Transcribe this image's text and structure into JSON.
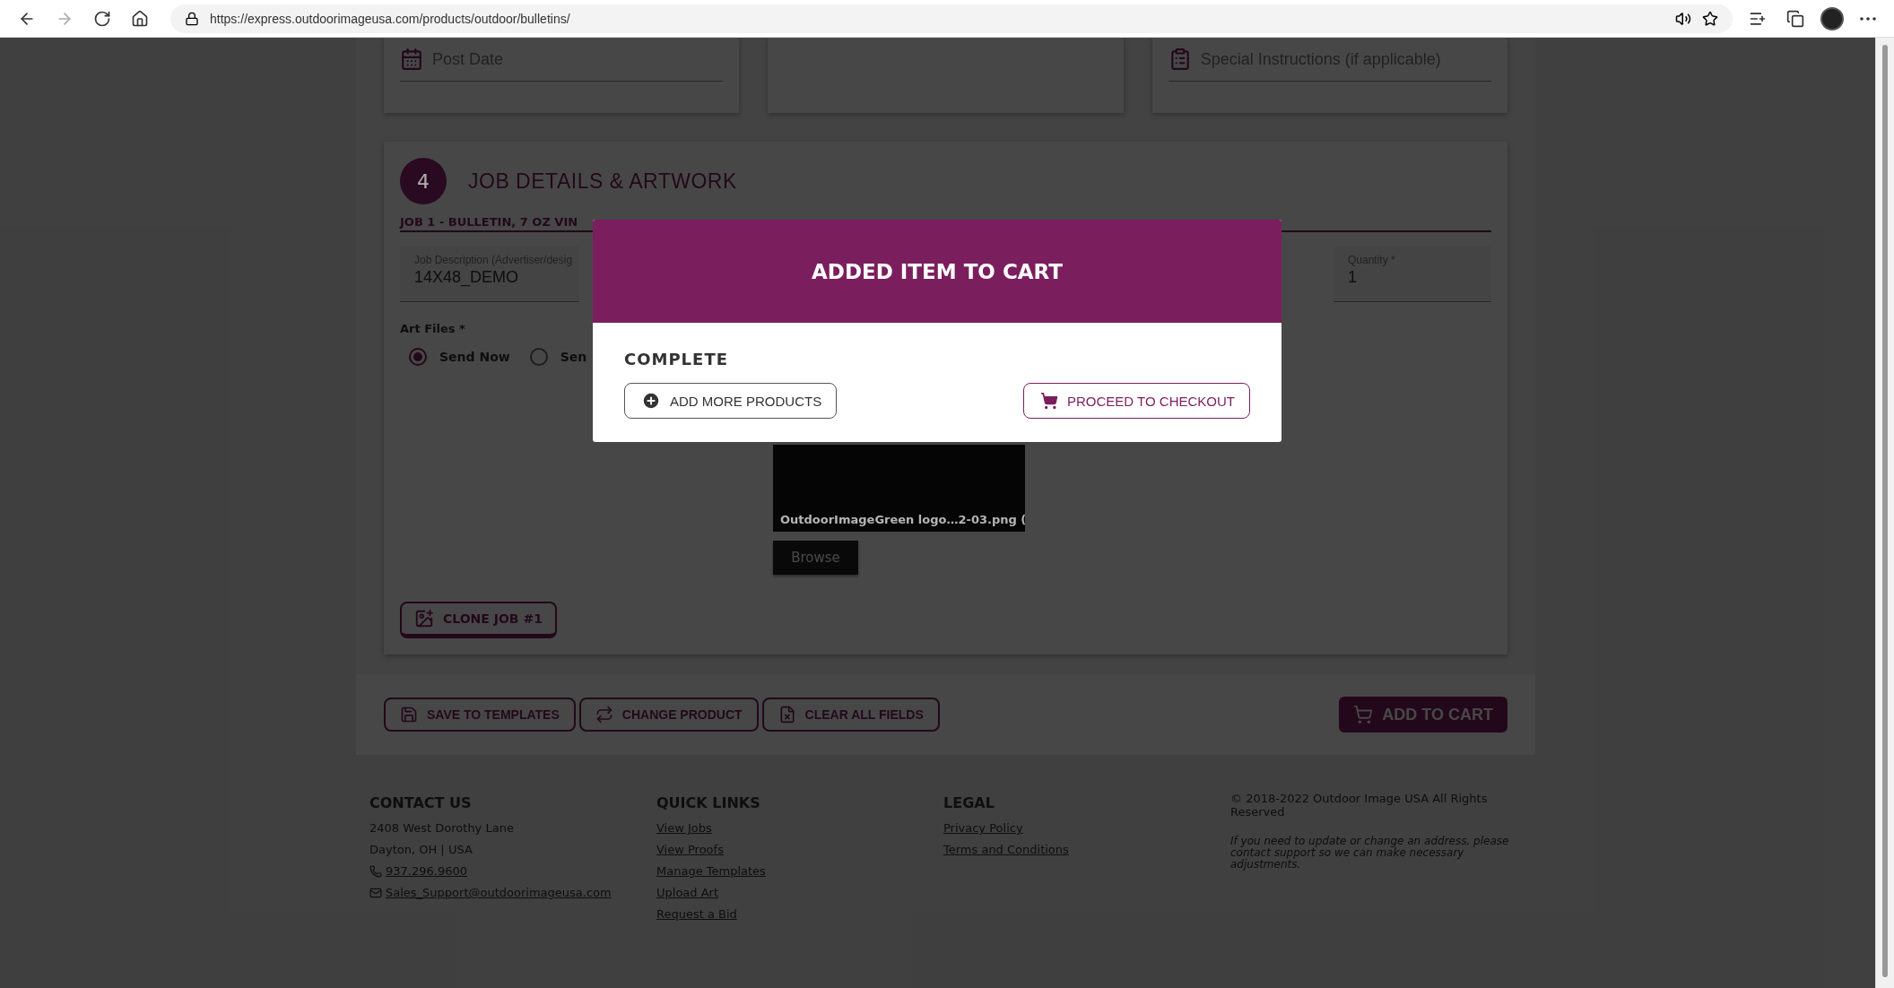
{
  "browser": {
    "url": "https://express.outdoorimageusa.com/products/outdoor/bulletins/"
  },
  "top_cards": [
    {
      "kind": "field",
      "placeholder": "Post Date"
    },
    {
      "kind": "blank"
    },
    {
      "kind": "field",
      "placeholder": "Special Instructions (if applicable)"
    }
  ],
  "section": {
    "number": "4",
    "title": "JOB DETAILS & ARTWORK",
    "job_title": "JOB 1 - BULLETIN, 7 OZ VIN",
    "fields": [
      {
        "label": "Job Description (Advertiser/desig",
        "value": "14X48_DEMO"
      },
      {
        "label": "Quantity *",
        "value": "1"
      }
    ],
    "art_files_label": "Art Files *",
    "art_options": [
      {
        "label": "Send Now",
        "selected": true
      },
      {
        "label": "Sen",
        "selected": false
      }
    ],
    "file_name": "OutdoorImageGreen logo…2-03.png (",
    "browse": "Browse",
    "clone": "CLONE JOB #1"
  },
  "actions": [
    {
      "label": "SAVE TO TEMPLATES"
    },
    {
      "label": "CHANGE PRODUCT"
    },
    {
      "label": "CLEAR ALL FIELDS"
    }
  ],
  "add_to_cart": "ADD TO CART",
  "footer": {
    "columns": [
      {
        "heading": "CONTACT US",
        "lines": [
          {
            "kind": "text",
            "text": "2408 West Dorothy Lane"
          },
          {
            "kind": "text",
            "text": "Dayton, OH | USA"
          },
          {
            "kind": "phone",
            "text": "937.296.9600"
          },
          {
            "kind": "mail",
            "text": "Sales_Support@outdoorimageusa.com"
          }
        ]
      },
      {
        "heading": "QUICK LINKS",
        "lines": [
          {
            "kind": "link",
            "text": "View Jobs"
          },
          {
            "kind": "link",
            "text": "View Proofs"
          },
          {
            "kind": "link",
            "text": "Manage Templates"
          },
          {
            "kind": "link",
            "text": "Upload Art"
          },
          {
            "kind": "link",
            "text": "Request a Bid"
          }
        ]
      },
      {
        "heading": "LEGAL",
        "lines": [
          {
            "kind": "link",
            "text": "Privacy Policy"
          },
          {
            "kind": "link",
            "text": "Terms and Conditions"
          }
        ]
      }
    ],
    "copyright": "© 2018-2022 Outdoor Image USA All Rights Reserved",
    "note": "If you need to update or change an address, please contact support so we can make necessary adjustments."
  },
  "modal": {
    "title": "ADDED ITEM TO CART",
    "status": "COMPLETE",
    "buttons": [
      {
        "label": "ADD MORE PRODUCTS",
        "kind": "secondary"
      },
      {
        "label": "PROCEED TO CHECKOUT",
        "kind": "primary"
      }
    ]
  }
}
